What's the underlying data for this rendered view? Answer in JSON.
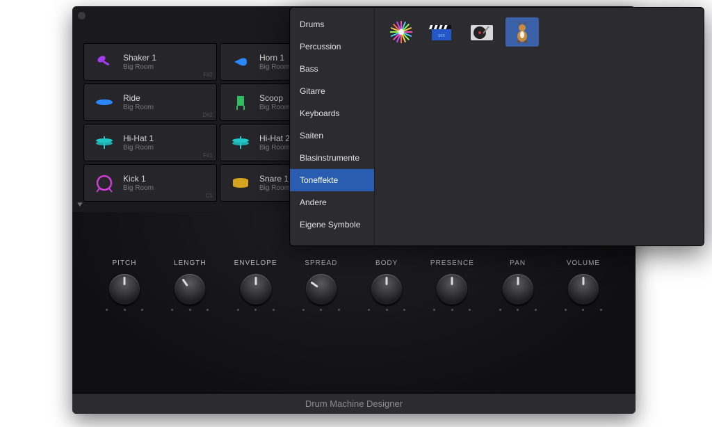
{
  "footer_title": "Drum Machine Designer",
  "disclosure_glyph": "▼",
  "pads": [
    {
      "name": "Shaker 1",
      "sub": "Big Room",
      "note": "F#2",
      "icon": "shaker",
      "color": "#a63cf0"
    },
    {
      "name": "Horn 1",
      "sub": "Big Room",
      "note": "",
      "icon": "horn",
      "color": "#2a87ff"
    },
    {
      "name": "",
      "sub": "",
      "note": "",
      "icon": "",
      "color": ""
    },
    {
      "name": "",
      "sub": "",
      "note": "",
      "icon": "",
      "color": ""
    },
    {
      "name": "Ride",
      "sub": "Big Room",
      "note": "D#2",
      "icon": "ride",
      "color": "#2a87ff"
    },
    {
      "name": "Scoop",
      "sub": "Big Room",
      "note": "",
      "icon": "scoop",
      "color": "#2fbf62"
    },
    {
      "name": "",
      "sub": "",
      "note": "",
      "icon": "",
      "color": ""
    },
    {
      "name": "",
      "sub": "",
      "note": "",
      "icon": "",
      "color": ""
    },
    {
      "name": "Hi-Hat 1",
      "sub": "Big Room",
      "note": "F#1",
      "icon": "hihat",
      "color": "#20c5c5"
    },
    {
      "name": "Hi-Hat 2",
      "sub": "Big Room",
      "note": "",
      "icon": "hihat",
      "color": "#20c5c5"
    },
    {
      "name": "",
      "sub": "",
      "note": "",
      "icon": "",
      "color": ""
    },
    {
      "name": "",
      "sub": "",
      "note": "",
      "icon": "",
      "color": ""
    },
    {
      "name": "Kick 1",
      "sub": "Big Room",
      "note": "C1",
      "icon": "kick",
      "color": "#d03cd6"
    },
    {
      "name": "Snare 1",
      "sub": "Big Room",
      "note": "",
      "icon": "snare",
      "color": "#d6a420"
    },
    {
      "name": "",
      "sub": "",
      "note": "",
      "icon": "",
      "color": ""
    },
    {
      "name": "",
      "sub": "",
      "note": "",
      "icon": "",
      "color": ""
    }
  ],
  "knobs": [
    {
      "label": "PITCH",
      "rot": 0
    },
    {
      "label": "LENGTH",
      "rot": -35
    },
    {
      "label": "ENVELOPE",
      "rot": 0
    },
    {
      "label": "SPREAD",
      "rot": -55
    },
    {
      "label": "BODY",
      "rot": 0
    },
    {
      "label": "PRESENCE",
      "rot": 0
    },
    {
      "label": "PAN",
      "rot": 0
    },
    {
      "label": "VOLUME",
      "rot": 0
    }
  ],
  "categories": [
    {
      "label": "Drums",
      "selected": false
    },
    {
      "label": "Percussion",
      "selected": false
    },
    {
      "label": "Bass",
      "selected": false
    },
    {
      "label": "Gitarre",
      "selected": false
    },
    {
      "label": "Keyboards",
      "selected": false
    },
    {
      "label": "Saiten",
      "selected": false
    },
    {
      "label": "Blasinstrumente",
      "selected": false
    },
    {
      "label": "Toneffekte",
      "selected": true
    },
    {
      "label": "Andere",
      "selected": false
    },
    {
      "label": "Eigene Symbole",
      "selected": false
    }
  ],
  "symbols": [
    {
      "name": "burst-icon",
      "selected": false
    },
    {
      "name": "clapper-icon",
      "selected": false
    },
    {
      "name": "turntable-icon",
      "selected": false
    },
    {
      "name": "dog-icon",
      "selected": true
    }
  ]
}
